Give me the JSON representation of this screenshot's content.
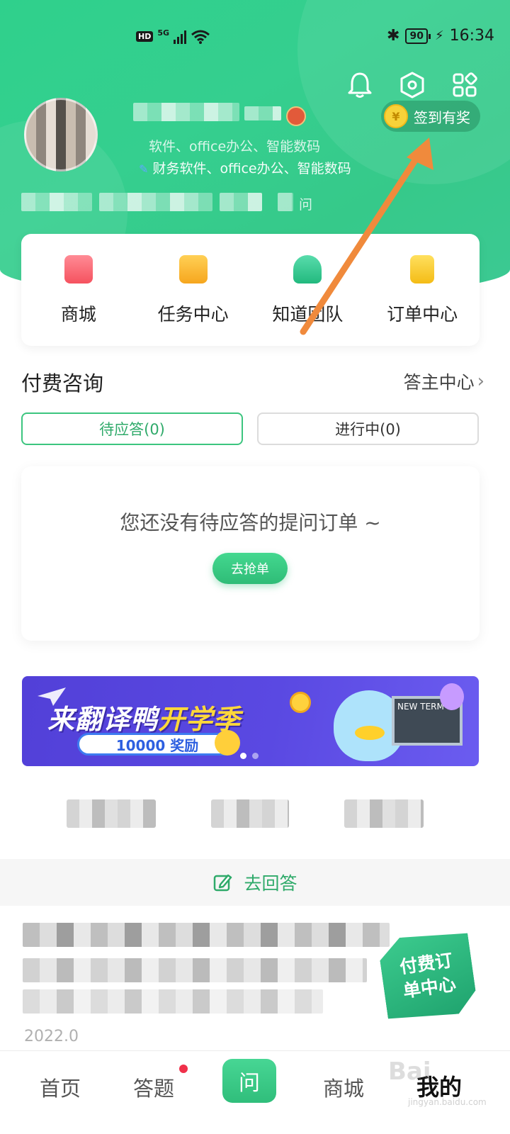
{
  "status_bar": {
    "hd": "HD",
    "network": "5G",
    "battery": "90",
    "time": "16:34"
  },
  "header": {
    "checkin_label": "签到有奖",
    "coin_symbol": "¥",
    "expertise_tags_partial": "软件、office办公、智能数码",
    "expertise_tags": "财务软件、office办公、智能数码",
    "stats_visible_fragment": "问"
  },
  "quick_menu": [
    {
      "label": "商城",
      "icon": "shop-bag-icon",
      "color": "#f7606b"
    },
    {
      "label": "任务中心",
      "icon": "task-calendar-icon",
      "color": "#f8b62a"
    },
    {
      "label": "知道团队",
      "icon": "team-people-icon",
      "color": "#2cc489"
    },
    {
      "label": "订单中心",
      "icon": "order-clipboard-icon",
      "color": "#f6c322"
    }
  ],
  "paid_consult": {
    "title": "付费咨询",
    "link": "答主中心",
    "tabs": [
      {
        "label": "待应答(0)",
        "active": true
      },
      {
        "label": "进行中(0)",
        "active": false
      }
    ],
    "empty_text": "您还没有待应答的提问订单 ~",
    "grab_button": "去抢单"
  },
  "banner": {
    "title_part1": "来翻译鸭",
    "title_part2": "开学季",
    "reward": "10000 奖励",
    "board_text": "NEW TERM"
  },
  "answer_bar": {
    "label": "去回答"
  },
  "list_item": {
    "date": "2022.0"
  },
  "paid_badge": {
    "line1": "付费订",
    "line2": "单中心"
  },
  "bottom_nav": [
    {
      "label": "首页",
      "active": false
    },
    {
      "label": "答题",
      "active": false,
      "dot": true
    },
    {
      "label": "问",
      "active": false
    },
    {
      "label": "商城",
      "active": false
    },
    {
      "label": "我的",
      "active": true
    }
  ],
  "watermark": {
    "text": "Bai",
    "sub": "jingyan.baidu.com"
  },
  "colors": {
    "brand_green": "#35cf8f",
    "active_green": "#2faa6a",
    "annotation_arrow": "#f08a3c",
    "notification_dot": "#f0304a"
  }
}
